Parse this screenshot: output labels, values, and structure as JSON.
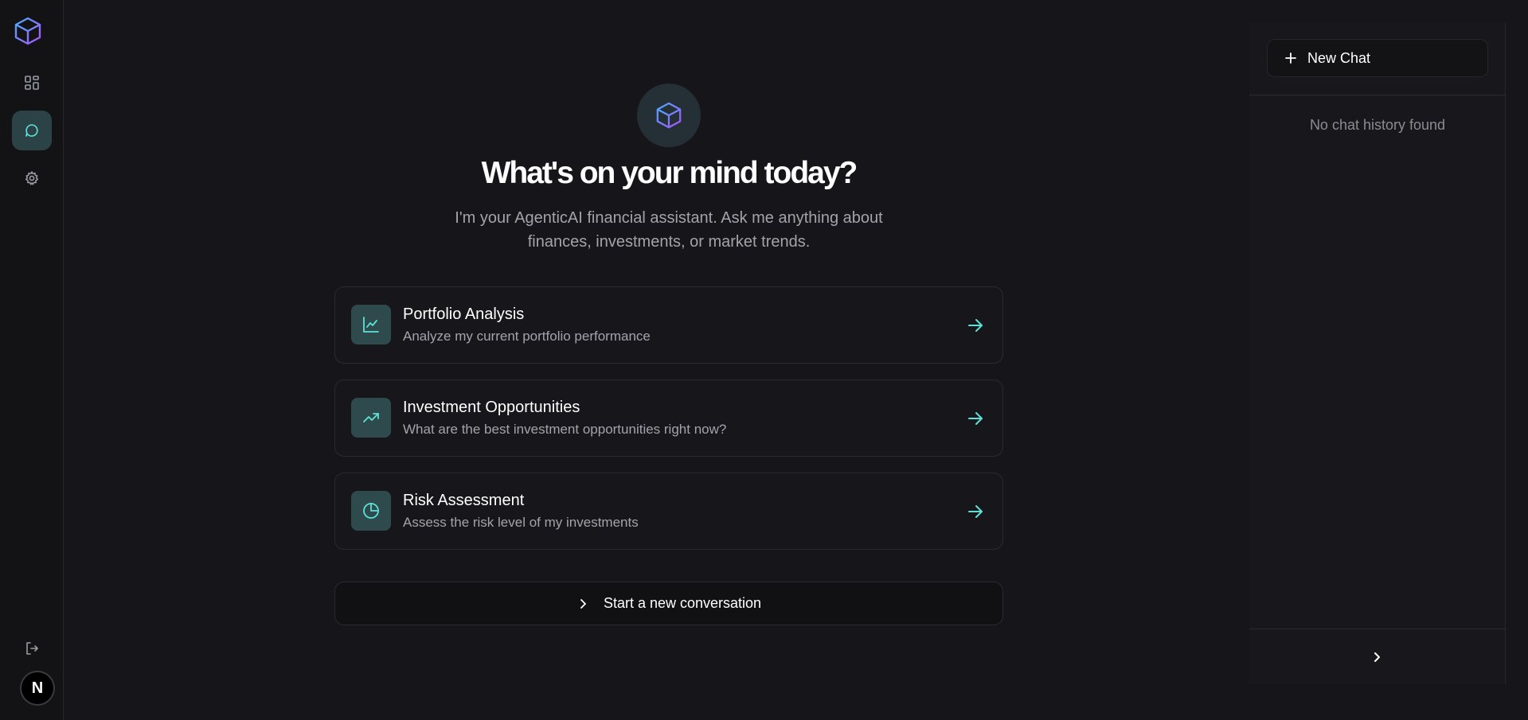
{
  "colors": {
    "accent": "#5ee2d8",
    "accent_bg": "#2e4a4c",
    "logo_gradient": [
      "#4fa8ff",
      "#a855f7"
    ],
    "background": "#16161a"
  },
  "rail": {
    "items": [
      {
        "name": "dashboard",
        "icon": "grid-icon",
        "active": false
      },
      {
        "name": "chat",
        "icon": "chat-bubble-icon",
        "active": true
      },
      {
        "name": "settings",
        "icon": "gear-icon",
        "active": false
      }
    ],
    "logout_icon": "logout-icon",
    "avatar_letter": "N"
  },
  "main": {
    "title": "What's on your mind today?",
    "subtitle": "I'm your AgenticAI financial assistant. Ask me anything about finances, investments, or market trends.",
    "suggestions": [
      {
        "title": "Portfolio Analysis",
        "description": "Analyze my current portfolio performance",
        "icon": "line-chart-icon"
      },
      {
        "title": "Investment Opportunities",
        "description": "What are the best investment opportunities right now?",
        "icon": "trending-up-icon"
      },
      {
        "title": "Risk Assessment",
        "description": "Assess the risk level of my investments",
        "icon": "pie-chart-icon"
      }
    ],
    "new_conversation_label": "Start a new conversation"
  },
  "history": {
    "new_chat_label": "New Chat",
    "empty_text": "No chat history found"
  }
}
